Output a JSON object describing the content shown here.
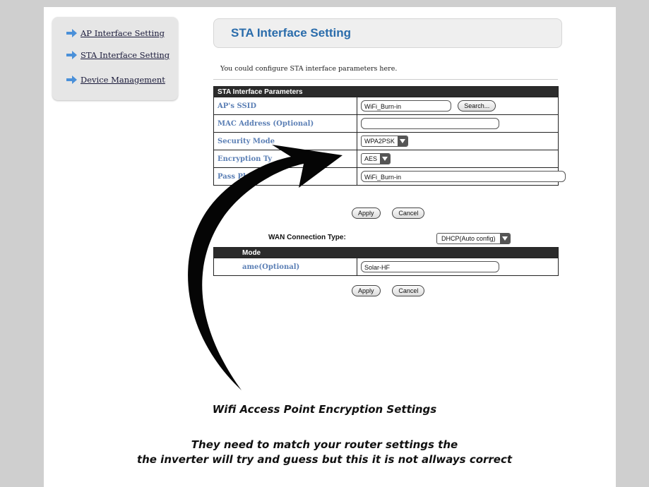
{
  "sidebar": {
    "items": [
      {
        "label": "AP Interface Setting"
      },
      {
        "label": "STA Interface Setting"
      },
      {
        "label": "Device Management"
      }
    ]
  },
  "header": {
    "title": "STA Interface Setting"
  },
  "description": "You could configure STA interface parameters here.",
  "sta_table": {
    "header": "STA Interface Parameters",
    "rows": {
      "ssid": {
        "label": "AP's SSID",
        "value": "WiFi_Burn-in",
        "search_button": "Search..."
      },
      "mac": {
        "label": "MAC Address (Optional)",
        "value": ""
      },
      "security": {
        "label": "Security Mode",
        "value": "WPA2PSK"
      },
      "encryption": {
        "label": "Encryption Ty",
        "value": "AES"
      },
      "passphrase": {
        "label": "Pass Ph",
        "value": "WiFi_Burn-in"
      }
    }
  },
  "buttons": {
    "apply": "Apply",
    "cancel": "Cancel"
  },
  "wan": {
    "label": "WAN Connection Type:",
    "value": "DHCP(Auto config)"
  },
  "mode_table": {
    "header": "Mode",
    "hostname_label": "ame(Optional)",
    "hostname_value": "Solar-HF"
  },
  "captions": {
    "line1": "Wifi Access Point Encryption Settings",
    "line2": "They need to match your router settings the",
    "line3": "the inverter will try and guess but this it is not allways correct"
  },
  "colors": {
    "accent": "#2a6cab",
    "label": "#5b7fb5",
    "nav_arrow": "#4a90d9"
  }
}
